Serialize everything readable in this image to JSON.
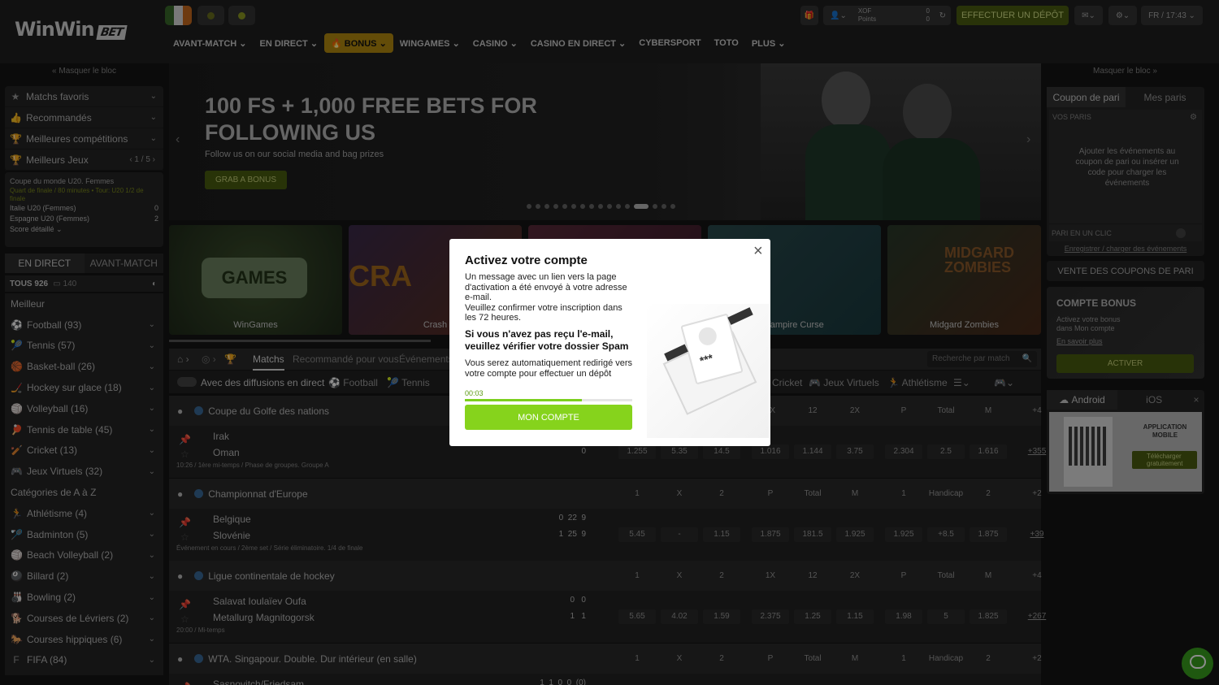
{
  "brand": {
    "name": "WinWin",
    "tag": "BET"
  },
  "nav": [
    {
      "label": "AVANT-MATCH ⌄",
      "active": false
    },
    {
      "label": "EN DIRECT ⌄",
      "active": false
    },
    {
      "label": "🔥 BONUS ⌄",
      "active": true
    },
    {
      "label": "WINGAMES ⌄",
      "active": false
    },
    {
      "label": "CASINO ⌄",
      "active": false
    },
    {
      "label": "CASINO EN DIRECT ⌄",
      "active": false
    },
    {
      "label": "CYBERSPORT",
      "active": false
    },
    {
      "label": "TOTO",
      "active": false
    },
    {
      "label": "PLUS ⌄",
      "active": false
    }
  ],
  "top": {
    "currency": "XOF",
    "points": "Points",
    "balance": "0",
    "points_value": "0",
    "deposit": "EFFECTUER UN DÉPÔT",
    "lang_time": "FR / 17:43 ⌄"
  },
  "left": {
    "hide": "« Masquer le bloc",
    "menu": [
      "Matchs favoris",
      "Recommandés",
      "Meilleures compétitions",
      "Meilleurs Jeux"
    ],
    "pager": "1 / 5",
    "mini": {
      "league": "Coupe du monde U20. Femmes",
      "note": "Quart de finale / 80 minutes • Tour: U20 1/2 de finale",
      "team1": "Italie U20 (Femmes)",
      "score1": "0",
      "team2": "Espagne U20 (Femmes)",
      "score2": "2",
      "detail": "Score détaillé ⌄"
    },
    "tabs": [
      "EN DIRECT",
      "AVANT-MATCH"
    ],
    "count_label": "TOUS 926",
    "count_stream": "140",
    "best": "Meilleur",
    "sports": [
      "Football (93)",
      "Tennis (57)",
      "Basket-ball (26)",
      "Hockey sur glace (18)",
      "Volleyball (16)",
      "Tennis de table (45)",
      "Cricket (13)",
      "Jeux Virtuels (32)"
    ],
    "cat_title": "Catégories de A à Z",
    "cats": [
      "Athlétisme (4)",
      "Badminton (5)",
      "Beach Volleyball (2)",
      "Billard (2)",
      "Bowling (2)",
      "Courses de Lévriers (2)",
      "Courses hippiques (6)",
      "FIFA (84)"
    ]
  },
  "banner": {
    "title_line1": "100 FS + 1,000 FREE BETS FOR",
    "title_line2": "FOLLOWING US",
    "subtitle": "Follow us on our social media and bag prizes",
    "cta": "GRAB A BONUS"
  },
  "games": [
    "WinGames",
    "Crash",
    "",
    "Vampire Curse",
    "Midgard Zombies"
  ],
  "mid": {
    "tabs": [
      "Matchs",
      "Recommandé pour vous",
      "Événements"
    ],
    "search": "Recherche par match",
    "live_toggle": "Avec des diffusions en direct",
    "filters": [
      "Football",
      "Tennis"
    ],
    "filters_right": [
      "Cricket",
      "Jeux Virtuels",
      "Athlétisme"
    ]
  },
  "matches": [
    {
      "league": "Coupe du Golfe des nations",
      "cols": [
        "1",
        "X",
        "2",
        "1X",
        "12",
        "2X",
        "P",
        "Total",
        "M",
        "+4"
      ],
      "team1": "Irak",
      "team2": "Oman",
      "s1": "0",
      "s2": "0",
      "info": "10:26 / 1ère mi-temps / Phase de groupes. Groupe A",
      "odds": [
        "1.255",
        "5.35",
        "14.5",
        "1.016",
        "1.144",
        "3.75",
        "2.304",
        "2.5",
        "1.616",
        "+355"
      ]
    },
    {
      "league": "Championnat d'Europe",
      "cols": [
        "1",
        "X",
        "2",
        "P",
        "Total",
        "M",
        "1",
        "Handicap",
        "2",
        "+2"
      ],
      "team1": "Belgique",
      "team2": "Slovénie",
      "s1": "0  22  9",
      "s2": "1  25  9",
      "info": "Événement en cours / 2ème set / Série éliminatoire. 1/4 de finale",
      "odds": [
        "5.45",
        "-",
        "1.15",
        "1.875",
        "181.5",
        "1.925",
        "1.925",
        "+8.5",
        "1.875",
        "+39"
      ]
    },
    {
      "league": "Ligue continentale de hockey",
      "cols": [
        "1",
        "X",
        "2",
        "1X",
        "12",
        "2X",
        "P",
        "Total",
        "M",
        "+4"
      ],
      "team1": "Salavat Ioulaïev Oufa",
      "team2": "Metallurg Magnitogorsk",
      "s1": "0   0",
      "s2": "1   1",
      "info": "20:00 / Mi-temps",
      "odds": [
        "5.65",
        "4.02",
        "1.59",
        "2.375",
        "1.25",
        "1.15",
        "1.98",
        "5",
        "1.825",
        "+267"
      ]
    },
    {
      "league": "WTA. Singapour. Double. Dur intérieur (en salle)",
      "cols": [
        "1",
        "X",
        "2",
        "P",
        "Total",
        "M",
        "1",
        "Handicap",
        "2",
        "+2"
      ],
      "team1": "Sasnovitch/Friedsam",
      "team2": "",
      "s1": "1  1  0  0  (0)",
      "s2": "",
      "info": "",
      "odds": []
    }
  ],
  "right": {
    "hide": "Masquer le bloc »",
    "tabs": [
      "Coupon de pari",
      "Mes paris"
    ],
    "my_bets": "VOS PARIS",
    "empty": "Ajouter les événements au coupon de pari ou insérer un code pour charger les événements",
    "one_click": "PARI EN UN CLIC",
    "save_load": "Enregistrer / charger des événements",
    "sell": "VENTE DES COUPONS DE PARI",
    "bonus_title": "COMPTE BONUS",
    "bonus_text": "Activez votre bonus dans Mon compte",
    "learn": "En savoir plus",
    "activate": "ACTIVER",
    "android": "Android",
    "ios": "iOS",
    "app_title": "APPLICATION MOBILE",
    "app_download": "Télécharger gratuitement"
  },
  "modal": {
    "title": "Activez votre compte",
    "p1": "Un message avec un lien vers la page d'activation a été envoyé à votre adresse e-mail.",
    "p2": "Veuillez confirmer votre inscription dans les 72 heures.",
    "bold": "Si vous n'avez pas reçu l'e-mail, veuillez vérifier votre dossier Spam",
    "p3": "Vous serez automatiquement redirigé vers votre compte pour effectuer un dépôt",
    "timer": "00:03",
    "progress": 0.7,
    "button": "MON COMPTE",
    "close": "×"
  }
}
